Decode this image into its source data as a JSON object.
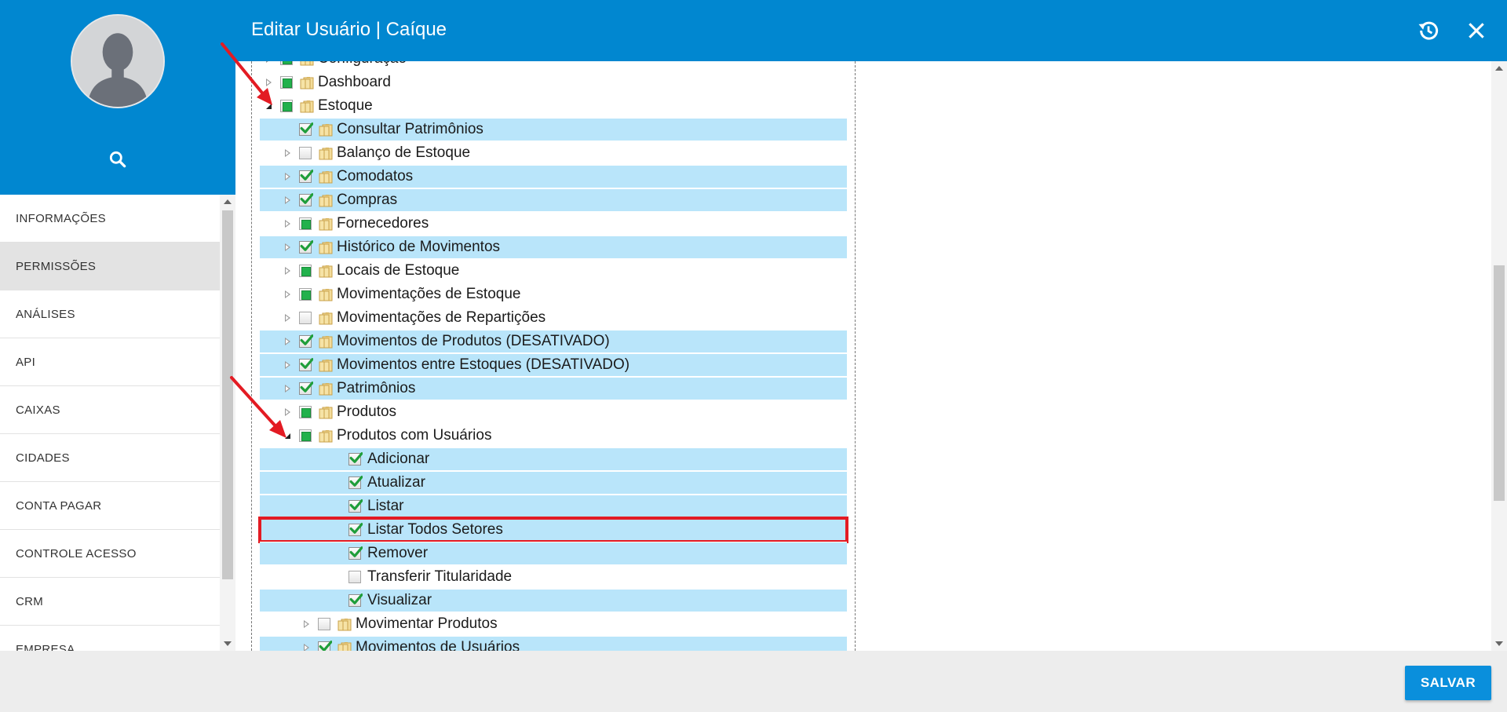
{
  "header": {
    "title": "Editar Usuário | Caíque",
    "history_icon": "history-icon",
    "close_icon": "close-icon",
    "background_color": "#0187d0"
  },
  "sidebar": {
    "avatar_icon": "user-avatar-icon",
    "search_icon": "search-icon",
    "items": [
      {
        "label": "INFORMAÇÕES",
        "active": false
      },
      {
        "label": "PERMISSÕES",
        "active": true
      },
      {
        "label": "ANÁLISES",
        "active": false
      },
      {
        "label": "API",
        "active": false
      },
      {
        "label": "CAIXAS",
        "active": false
      },
      {
        "label": "CIDADES",
        "active": false
      },
      {
        "label": "CONTA PAGAR",
        "active": false
      },
      {
        "label": "CONTROLE ACESSO",
        "active": false
      },
      {
        "label": "CRM",
        "active": false
      },
      {
        "label": "EMPRESA",
        "active": false
      }
    ]
  },
  "tree": {
    "selected_color": "#b9e5fa",
    "nodes": [
      {
        "label": "Configuração",
        "level": 0,
        "toggle": "collapsed",
        "check": "partial",
        "folder": true,
        "selected": false
      },
      {
        "label": "Dashboard",
        "level": 0,
        "toggle": "collapsed",
        "check": "partial",
        "folder": true,
        "selected": false
      },
      {
        "label": "Estoque",
        "level": 0,
        "toggle": "expanded",
        "check": "partial",
        "folder": true,
        "selected": false
      },
      {
        "label": "Consultar Patrimônios",
        "level": 1,
        "toggle": "none",
        "check": "checked",
        "folder": true,
        "selected": true
      },
      {
        "label": "Balanço de Estoque",
        "level": 1,
        "toggle": "collapsed",
        "check": "unchecked",
        "folder": true,
        "selected": false
      },
      {
        "label": "Comodatos",
        "level": 1,
        "toggle": "collapsed",
        "check": "checked",
        "folder": true,
        "selected": true
      },
      {
        "label": "Compras",
        "level": 1,
        "toggle": "collapsed",
        "check": "checked",
        "folder": true,
        "selected": true
      },
      {
        "label": "Fornecedores",
        "level": 1,
        "toggle": "collapsed",
        "check": "partial",
        "folder": true,
        "selected": false
      },
      {
        "label": "Histórico de Movimentos",
        "level": 1,
        "toggle": "collapsed",
        "check": "checked",
        "folder": true,
        "selected": true
      },
      {
        "label": "Locais de Estoque",
        "level": 1,
        "toggle": "collapsed",
        "check": "partial",
        "folder": true,
        "selected": false
      },
      {
        "label": "Movimentações de Estoque",
        "level": 1,
        "toggle": "collapsed",
        "check": "partial",
        "folder": true,
        "selected": false
      },
      {
        "label": "Movimentações de Repartições",
        "level": 1,
        "toggle": "collapsed",
        "check": "unchecked",
        "folder": true,
        "selected": false
      },
      {
        "label": "Movimentos de Produtos (DESATIVADO)",
        "level": 1,
        "toggle": "collapsed",
        "check": "checked",
        "folder": true,
        "selected": true
      },
      {
        "label": "Movimentos entre Estoques (DESATIVADO)",
        "level": 1,
        "toggle": "collapsed",
        "check": "checked",
        "folder": true,
        "selected": true
      },
      {
        "label": "Patrimônios",
        "level": 1,
        "toggle": "collapsed",
        "check": "checked",
        "folder": true,
        "selected": true
      },
      {
        "label": "Produtos",
        "level": 1,
        "toggle": "collapsed",
        "check": "partial",
        "folder": true,
        "selected": false
      },
      {
        "label": "Produtos com Usuários",
        "level": 1,
        "toggle": "expanded",
        "check": "partial",
        "folder": true,
        "selected": false
      },
      {
        "label": "Adicionar",
        "level": 2,
        "toggle": "none",
        "check": "checked",
        "folder": false,
        "selected": true
      },
      {
        "label": "Atualizar",
        "level": 2,
        "toggle": "none",
        "check": "checked",
        "folder": false,
        "selected": true
      },
      {
        "label": "Listar",
        "level": 2,
        "toggle": "none",
        "check": "checked",
        "folder": false,
        "selected": true
      },
      {
        "label": "Listar Todos Setores",
        "level": 2,
        "toggle": "none",
        "check": "checked",
        "folder": false,
        "selected": true,
        "highlighted": true
      },
      {
        "label": "Remover",
        "level": 2,
        "toggle": "none",
        "check": "checked",
        "folder": false,
        "selected": true
      },
      {
        "label": "Transferir Titularidade",
        "level": 2,
        "toggle": "none",
        "check": "unchecked",
        "folder": false,
        "selected": false
      },
      {
        "label": "Visualizar",
        "level": 2,
        "toggle": "none",
        "check": "checked",
        "folder": false,
        "selected": true
      },
      {
        "label": "Movimentar Produtos",
        "level": 2,
        "toggle": "collapsed",
        "check": "unchecked",
        "folder": true,
        "selected": false
      },
      {
        "label": "Movimentos de Usuários",
        "level": 2,
        "toggle": "collapsed",
        "check": "checked",
        "folder": true,
        "selected": true
      }
    ]
  },
  "annotations": {
    "arrow_color": "#e31b23",
    "highlight_color": "#e31b23"
  },
  "footer": {
    "save_label": "SALVAR"
  }
}
